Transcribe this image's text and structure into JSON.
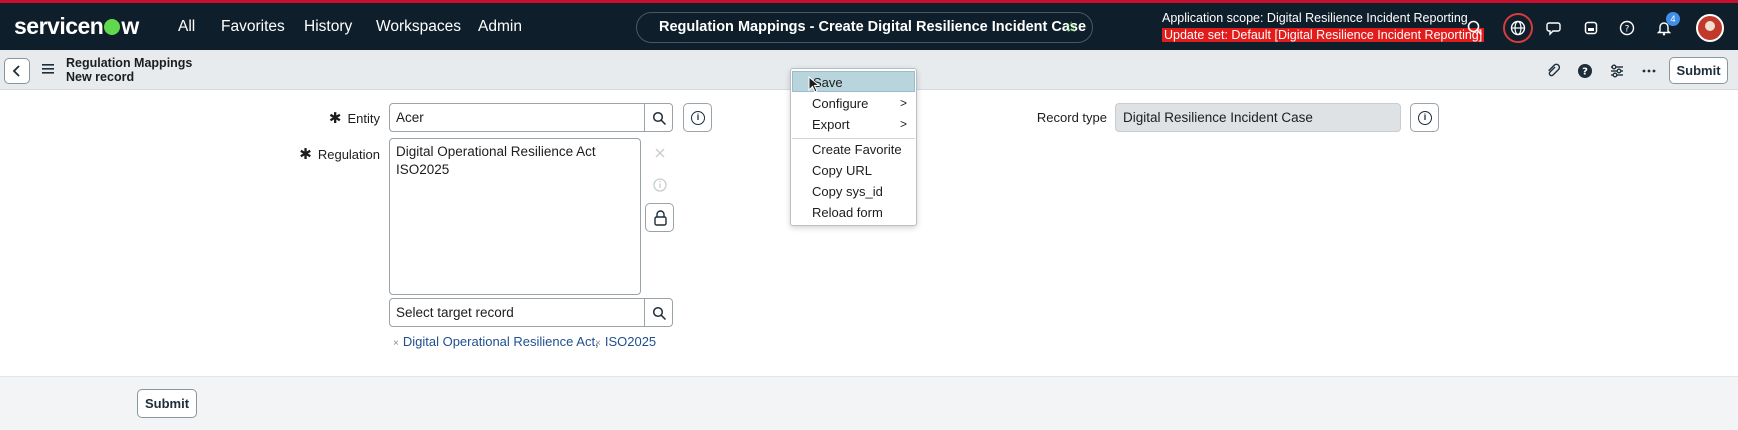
{
  "topbar": {
    "logo": "servicenow",
    "nav": [
      "All",
      "Favorites",
      "History",
      "Workspaces",
      "Admin"
    ],
    "title": "Regulation Mappings - Create Digital Resilience Incident Case",
    "scope": "Application scope: Digital Resilience Incident Reporting",
    "update_set": "Update set: Default [Digital Resilience Incident Reporting]",
    "notification_count": "4",
    "icons": [
      "search-icon",
      "globe-icon",
      "chat-icon",
      "studio-icon",
      "help-icon",
      "bell-icon"
    ]
  },
  "record": {
    "table": "Regulation Mappings",
    "subtitle": "New record",
    "submit_label": "Submit",
    "header_icons": [
      "paperclip-icon",
      "help-icon",
      "settings-sliders-icon",
      "more-icon"
    ]
  },
  "form": {
    "entity_label": "Entity",
    "entity_value": "Acer",
    "regulation_label": "Regulation",
    "regulation_values": [
      "Digital Operational Resilience Act",
      "ISO2025"
    ],
    "target_placeholder": "Select target record",
    "tags": [
      "Digital Operational Resilience Act,",
      "ISO2025"
    ],
    "record_type_label": "Record type",
    "record_type_value": "Digital Resilience Incident Case",
    "required_marker": "✱"
  },
  "context_menu": {
    "items": [
      {
        "label": "Save",
        "active": true
      },
      {
        "label": "Configure",
        "submenu": true
      },
      {
        "label": "Export",
        "submenu": true
      },
      {
        "label": "Create Favorite"
      },
      {
        "label": "Copy URL"
      },
      {
        "label": "Copy sys_id"
      },
      {
        "label": "Reload form"
      }
    ]
  },
  "footer": {
    "submit_label": "Submit"
  },
  "colors": {
    "topbar": "#0f1e2b",
    "accent_green": "#62d84e",
    "update_set_bg": "#e21b1b",
    "link": "#1f4f8f"
  }
}
